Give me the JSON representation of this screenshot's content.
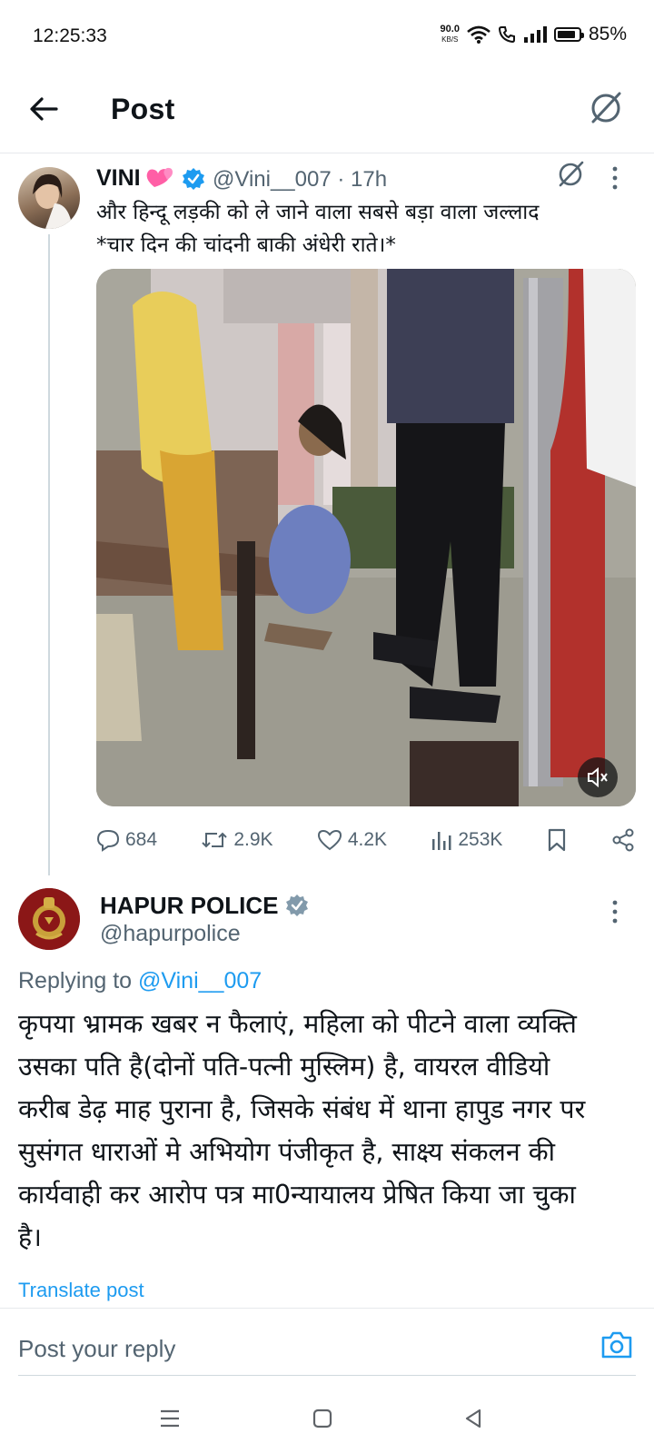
{
  "status_bar": {
    "time": "12:25:33",
    "net_speed": "90.0",
    "net_unit": "KB/S",
    "battery": "85%"
  },
  "header": {
    "title": "Post"
  },
  "tweet1": {
    "name": "VINI",
    "handle_time": "@Vini__007 · 17h",
    "text_line1": "और हिन्दू लड़की को ले जाने वाला सबसे बड़ा वाला जल्लाद",
    "text_line2": "*चार दिन की चांदनी बाकी अंधेरी राते।*",
    "stats": {
      "replies": "684",
      "reposts": "2.9K",
      "likes": "4.2K",
      "views": "253K"
    }
  },
  "tweet2": {
    "name": "HAPUR POLICE",
    "handle": "@hapurpolice",
    "replying_prefix": "Replying to",
    "replying_to": "@Vini__007",
    "text": [
      "कृपया भ्रामक खबर न फैलाएं, महिला को पीटने वाला व्यक्ति",
      "उसका पति है(दोनों पति-पत्नी मुस्लिम) है, वायरल वीडियो",
      "करीब डेढ़ माह पुराना है, जिसके संबंध में थाना हापुड नगर पर",
      "सुसंगत धाराओं मे अभियोग पंजीकृत है, साक्ष्य संकलन की",
      "कार्यवाही कर आरोप पत्र मा0न्यायालय प्रेषित किया जा चुका",
      "है।"
    ],
    "translate_label": "Translate post"
  },
  "reply_bar": {
    "placeholder": "Post your reply"
  },
  "colors": {
    "accent": "#1d9bf0",
    "secondary_text": "#536471",
    "divider": "#e6e9ec"
  }
}
